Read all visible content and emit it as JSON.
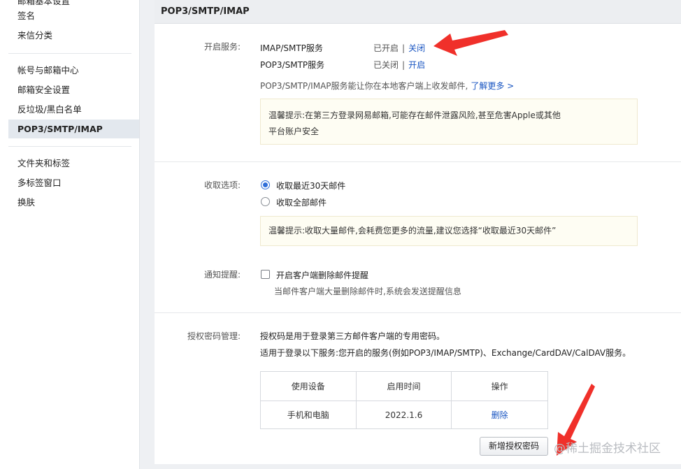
{
  "sidebar": {
    "partial_top": "邮箱基本设置",
    "items": [
      {
        "label": "签名"
      },
      {
        "label": "来信分类"
      },
      {
        "label": "帐号与邮箱中心"
      },
      {
        "label": "邮箱安全设置"
      },
      {
        "label": "反垃圾/黑白名单"
      },
      {
        "label": "POP3/SMTP/IMAP",
        "active": true
      },
      {
        "label": "文件夹和标签"
      },
      {
        "label": "多标签窗口"
      },
      {
        "label": "换肤"
      }
    ]
  },
  "panel": {
    "title": "POP3/SMTP/IMAP",
    "services": {
      "label": "开启服务:",
      "rows": [
        {
          "name": "IMAP/SMTP服务",
          "status": "已开启",
          "action": "关闭"
        },
        {
          "name": "POP3/SMTP服务",
          "status": "已关闭",
          "action": "开启"
        }
      ],
      "desc": "POP3/SMTP/IMAP服务能让你在本地客户端上收发邮件,",
      "learn_more": "了解更多 >",
      "tip_line1": "温馨提示:在第三方登录网易邮箱,可能存在邮件泄露风险,甚至危害Apple或其他",
      "tip_line2": "平台账户安全"
    },
    "receive": {
      "label": "收取选项:",
      "options": [
        {
          "label": "收取最近30天邮件",
          "selected": true
        },
        {
          "label": "收取全部邮件",
          "selected": false
        }
      ],
      "tip": "温馨提示:收取大量邮件,会耗费您更多的流量,建议您选择“收取最近30天邮件”"
    },
    "notify": {
      "label": "通知提醒:",
      "checkbox_label": "开启客户端删除邮件提醒",
      "checked": false,
      "desc": "当邮件客户端大量删除邮件时,系统会发送提醒信息"
    },
    "auth": {
      "label": "授权密码管理:",
      "line1": "授权码是用于登录第三方邮件客户端的专用密码。",
      "line2": "适用于登录以下服务:您开启的服务(例如POP3/IMAP/SMTP)、Exchange/CardDAV/CalDAV服务。",
      "columns": [
        "使用设备",
        "启用时间",
        "操作"
      ],
      "rows": [
        {
          "device": "手机和电脑",
          "time": "2022.1.6",
          "action": "删除"
        }
      ],
      "add_button": "新增授权密码"
    }
  },
  "watermark": "@稀土掘金技术社区",
  "colors": {
    "link": "#1a56c2",
    "arrow": "#f0302a",
    "active_item": "#e3e8ee",
    "tip_bg": "#fefdf3"
  }
}
